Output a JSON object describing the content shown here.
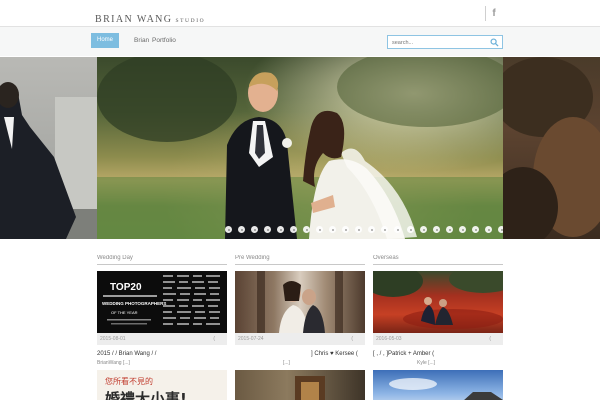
{
  "header": {
    "logo_main": "BRIAN WANG",
    "logo_sub": "STUDIO",
    "facebook_icon_text": "f"
  },
  "nav": {
    "home": "Home",
    "item_brian": "Brian",
    "item_portfolio": "Portfolio"
  },
  "search": {
    "placeholder": "search..."
  },
  "slider": {
    "dot_count": 26
  },
  "columns": [
    {
      "title": "Wedding Day",
      "date": "2015-08-01",
      "paren": "(",
      "post_title": "2015            /          /          Brian Wang           /          /",
      "post_sub": "BrianWang            [...]",
      "thumb_text_top": "TOP20",
      "thumb_text_mid": "WEDDING PHOTOGRAPHERS",
      "thumb_text_small": "OF THE YEAR",
      "next_thumb_text_1": "您所看不見的",
      "next_thumb_text_2": "婚禮大小事!"
    },
    {
      "title": "Pre Wedding",
      "date": "2015-07-24",
      "paren": "(",
      "post_title": "] Chris ♥ Kersee (",
      "post_sub": "[...]"
    },
    {
      "title": "Overseas",
      "date": "2016-05-03",
      "paren": "(",
      "post_title": "[       ,       /       ,       ]Patrick + Amber (",
      "post_sub": "Kyle [...]"
    }
  ],
  "colors": {
    "accent": "#7dbde0",
    "search_border": "#8ec4e3"
  }
}
